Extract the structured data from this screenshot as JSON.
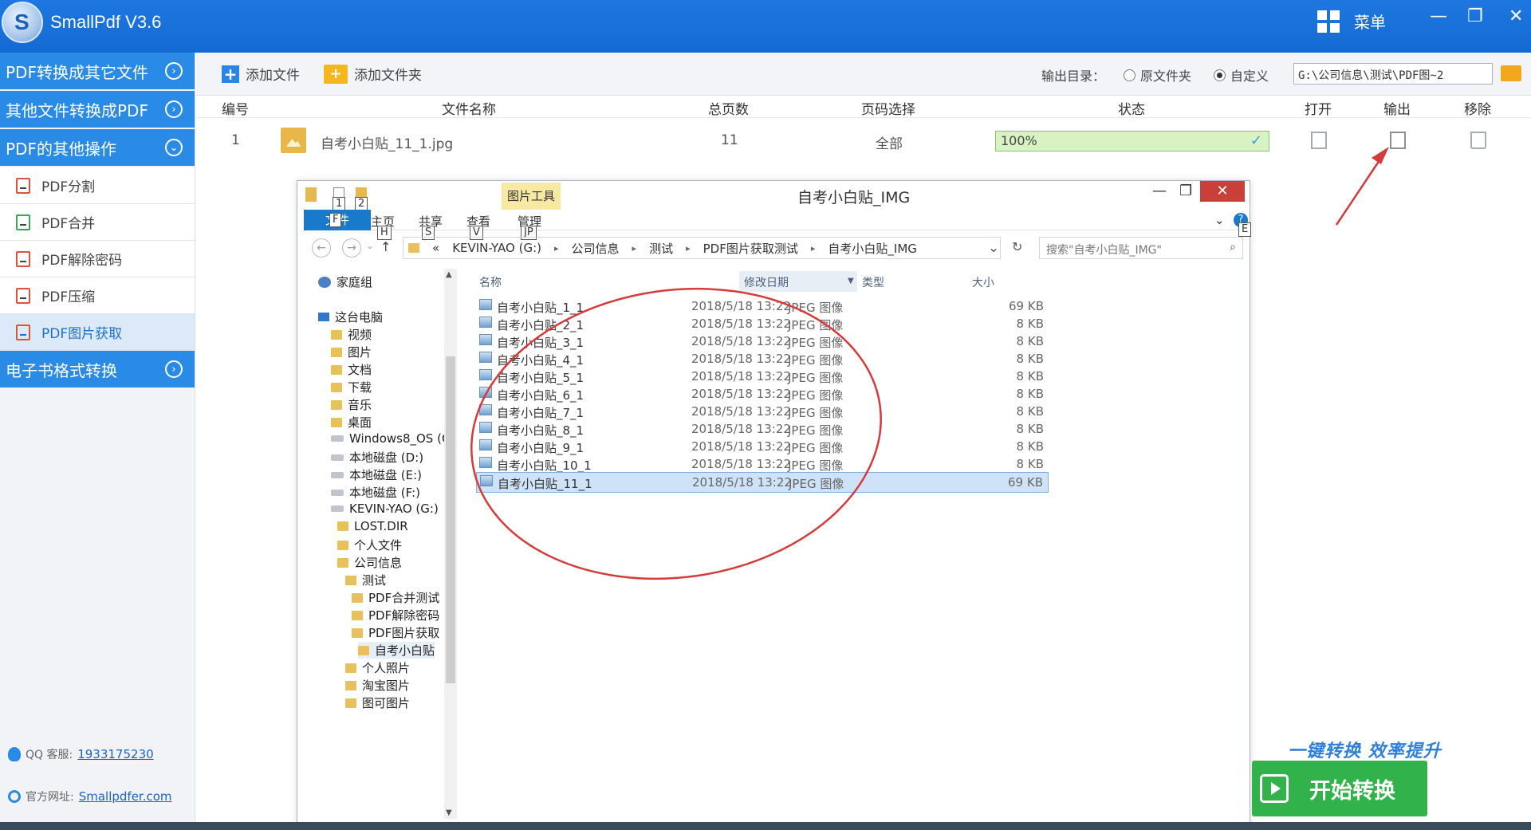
{
  "app": {
    "logo_letter": "S",
    "title": "SmallPdf V3.6",
    "menu_label": "菜单",
    "min": "—",
    "max": "❐",
    "close": "✕"
  },
  "sidebar": {
    "sections": [
      {
        "label": "PDF转换成其它文件",
        "toggle": "›"
      },
      {
        "label": "其他文件转换成PDF",
        "toggle": "›"
      },
      {
        "label": "PDF的其他操作",
        "toggle": "⌄"
      }
    ],
    "items": [
      {
        "label": "PDF分割"
      },
      {
        "label": "PDF合并"
      },
      {
        "label": "PDF解除密码"
      },
      {
        "label": "PDF压缩"
      },
      {
        "label": "PDF图片获取"
      }
    ],
    "last_section": {
      "label": "电子书格式转换",
      "toggle": "›"
    },
    "qq_label": "QQ 客服:",
    "qq_number": "1933175230",
    "site_label": "官方网址:",
    "site_url": "Smallpdfer.com"
  },
  "toolbar": {
    "add_file": "添加文件",
    "add_folder": "添加文件夹",
    "output_dir_label": "输出目录：",
    "opt_source": "原文件夹",
    "opt_custom": "自定义",
    "path_value": "G:\\公司信息\\测试\\PDF图~2"
  },
  "columns": {
    "num": "编号",
    "name": "文件名称",
    "pages": "总页数",
    "range": "页码选择",
    "status": "状态",
    "open": "打开",
    "output": "输出",
    "remove": "移除"
  },
  "file_row": {
    "num": "1",
    "name": "自考小白贴_11_1.jpg",
    "pages": "11",
    "range": "全部",
    "progress_text": "100%",
    "progress": 1.0,
    "check": "✓"
  },
  "explorer": {
    "title": "自考小白贴_IMG",
    "pic_tools": "图片工具",
    "ribbon": {
      "file": "文件",
      "home": "主页",
      "share": "共享",
      "view": "查看",
      "manage": "管理",
      "expand": "⌄",
      "help": "?"
    },
    "keytips": {
      "qa1": "1",
      "qa2": "2",
      "file": "F",
      "home": "H",
      "share": "S",
      "view": "V",
      "manage": "JP",
      "help": "E"
    },
    "nav": {
      "back": "←",
      "forward": "→",
      "recent": "⌄",
      "up": "↑",
      "refresh": "↻",
      "dropdown": "⌄"
    },
    "address": [
      "«",
      "KEVIN-YAO (G:)",
      "公司信息",
      "测试",
      "PDF图片获取测试",
      "自考小白贴_IMG"
    ],
    "search_placeholder": "搜索\"自考小白贴_IMG\"",
    "search_icon": "⌕",
    "tree": [
      {
        "label": "家庭组",
        "icon": "homegroup"
      },
      {
        "label": "这台电脑",
        "icon": "pc"
      },
      {
        "label": "视频",
        "icon": "folder"
      },
      {
        "label": "图片",
        "icon": "folder"
      },
      {
        "label": "文档",
        "icon": "folder"
      },
      {
        "label": "下载",
        "icon": "folder"
      },
      {
        "label": "音乐",
        "icon": "folder"
      },
      {
        "label": "桌面",
        "icon": "folder"
      },
      {
        "label": "Windows8_OS (C",
        "icon": "drive"
      },
      {
        "label": "本地磁盘 (D:)",
        "icon": "drive"
      },
      {
        "label": "本地磁盘 (E:)",
        "icon": "drive"
      },
      {
        "label": "本地磁盘 (F:)",
        "icon": "drive"
      },
      {
        "label": "KEVIN-YAO (G:)",
        "icon": "drive"
      },
      {
        "label": "LOST.DIR",
        "icon": "folder"
      },
      {
        "label": "个人文件",
        "icon": "folder"
      },
      {
        "label": "公司信息",
        "icon": "folder"
      },
      {
        "label": "测试",
        "icon": "folder"
      },
      {
        "label": "PDF合并测试",
        "icon": "folder"
      },
      {
        "label": "PDF解除密码",
        "icon": "folder"
      },
      {
        "label": "PDF图片获取",
        "icon": "folder"
      },
      {
        "label": "自考小白贴",
        "icon": "folder"
      },
      {
        "label": "个人照片",
        "icon": "folder"
      },
      {
        "label": "淘宝图片",
        "icon": "folder"
      },
      {
        "label": "图可图片",
        "icon": "folder"
      }
    ],
    "list_headers": {
      "name": "名称",
      "date": "修改日期",
      "type": "类型",
      "size": "大小"
    },
    "files": [
      {
        "name": "自考小白贴_1_1",
        "date": "2018/5/18 13:22",
        "type": "JPEG 图像",
        "size": "69 KB"
      },
      {
        "name": "自考小白贴_2_1",
        "date": "2018/5/18 13:22",
        "type": "JPEG 图像",
        "size": "8 KB"
      },
      {
        "name": "自考小白贴_3_1",
        "date": "2018/5/18 13:22",
        "type": "JPEG 图像",
        "size": "8 KB"
      },
      {
        "name": "自考小白贴_4_1",
        "date": "2018/5/18 13:22",
        "type": "JPEG 图像",
        "size": "8 KB"
      },
      {
        "name": "自考小白贴_5_1",
        "date": "2018/5/18 13:22",
        "type": "JPEG 图像",
        "size": "8 KB"
      },
      {
        "name": "自考小白贴_6_1",
        "date": "2018/5/18 13:22",
        "type": "JPEG 图像",
        "size": "8 KB"
      },
      {
        "name": "自考小白贴_7_1",
        "date": "2018/5/18 13:22",
        "type": "JPEG 图像",
        "size": "8 KB"
      },
      {
        "name": "自考小白贴_8_1",
        "date": "2018/5/18 13:22",
        "type": "JPEG 图像",
        "size": "8 KB"
      },
      {
        "name": "自考小白贴_9_1",
        "date": "2018/5/18 13:22",
        "type": "JPEG 图像",
        "size": "8 KB"
      },
      {
        "name": "自考小白贴_10_1",
        "date": "2018/5/18 13:22",
        "type": "JPEG 图像",
        "size": "8 KB"
      },
      {
        "name": "自考小白贴_11_1",
        "date": "2018/5/18 13:22",
        "type": "JPEG 图像",
        "size": "69 KB"
      }
    ],
    "selected_index": 10
  },
  "footer": {
    "slogan": "一键转换  效率提升",
    "start_button": "开始转换"
  },
  "colors": {
    "brand_blue": "#1e77e0",
    "sidebar_blue": "#2a8be6",
    "start_green": "#32b24a",
    "annotation_red": "#d63a3a"
  }
}
